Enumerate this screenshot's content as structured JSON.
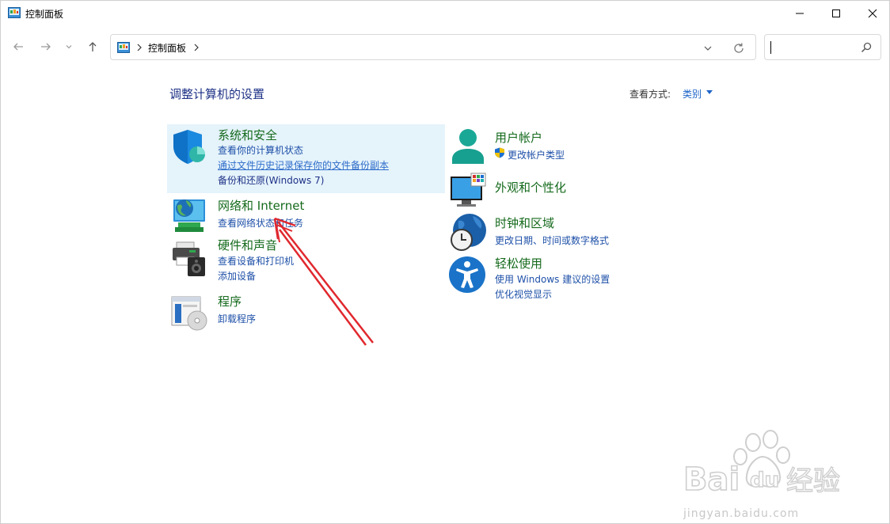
{
  "window": {
    "title": "控制面板"
  },
  "address": {
    "crumb": "控制面板",
    "search_placeholder": ""
  },
  "header": {
    "title": "调整计算机的设置",
    "viewby_label": "查看方式:",
    "viewby_value": "类别"
  },
  "categories": [
    {
      "title": "系统和安全",
      "links": [
        "查看你的计算机状态",
        "通过文件历史记录保存你的文件备份副本",
        "备份和还原(Windows 7)"
      ]
    },
    {
      "title": "网络和 Internet",
      "links": [
        "查看网络状态和任务"
      ]
    },
    {
      "title": "硬件和声音",
      "links": [
        "查看设备和打印机",
        "添加设备"
      ]
    },
    {
      "title": "程序",
      "links": [
        "卸载程序"
      ]
    },
    {
      "title": "用户帐户",
      "links": [
        "更改帐户类型"
      ]
    },
    {
      "title": "外观和个性化",
      "links": []
    },
    {
      "title": "时钟和区域",
      "links": [
        "更改日期、时间或数字格式"
      ]
    },
    {
      "title": "轻松使用",
      "links": [
        "使用 Windows 建议的设置",
        "优化视觉显示"
      ]
    }
  ],
  "watermark": {
    "text": "jingyan.baidu.com",
    "logo": "Bai du 经验"
  },
  "colors": {
    "title_blue": "#1e3287",
    "category_green": "#156a1c",
    "link_blue": "#1e50a8",
    "highlight": "#e5f3fb",
    "annotation_red": "#e0282e"
  }
}
